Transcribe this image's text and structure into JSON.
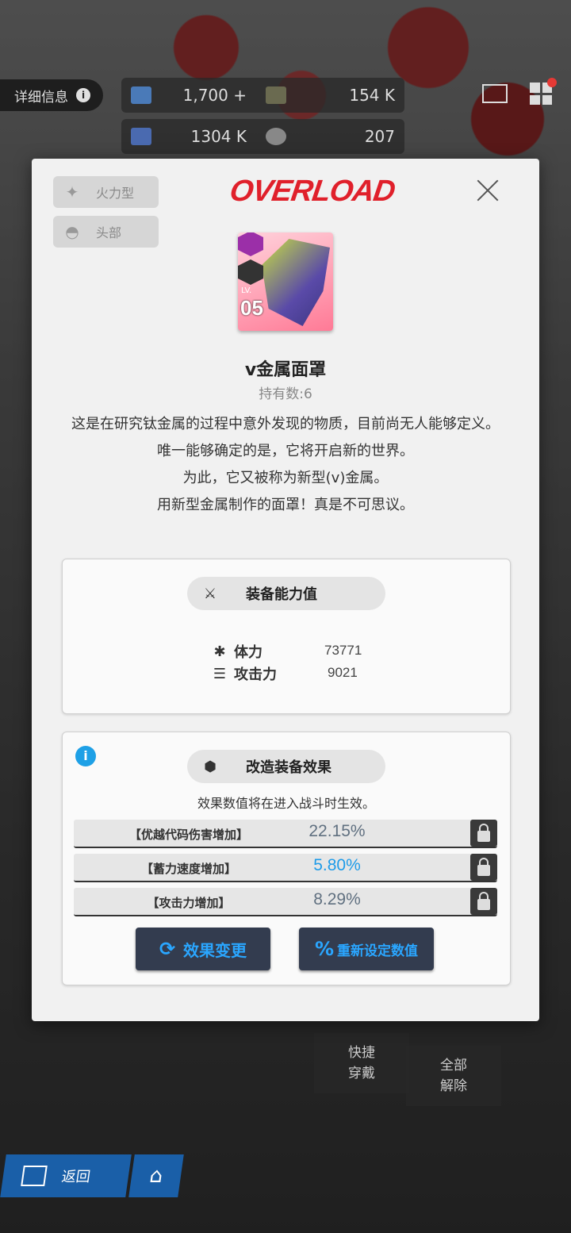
{
  "topbar": {
    "detail_label": "详细信息",
    "resources": [
      {
        "icon": "gem-icon",
        "value": "1,700",
        "extra": "+"
      },
      {
        "icon": "credit-card-icon",
        "value": "154 K"
      },
      {
        "icon": "battery-icon",
        "value": "1304 K"
      },
      {
        "icon": "core-orb-icon",
        "value": "207"
      }
    ]
  },
  "modal": {
    "tags": [
      "火力型",
      "头部"
    ],
    "brand": "OVERLOAD",
    "item": {
      "lv_label": "LV.",
      "level": "05",
      "name": "v金属面罩",
      "owned": "持有数:6"
    },
    "description": [
      "这是在研究钛金属的过程中意外发现的物质，目前尚无人能够定义。",
      "唯一能够确定的是，它将开启新的世界。",
      "为此，它又被称为新型(v)金属。",
      "用新型金属制作的面罩！真是不可思议。"
    ],
    "stats_section": {
      "title": "装备能力值",
      "stats": [
        {
          "icon": "asterisk-icon",
          "label": "体力",
          "value": "73771"
        },
        {
          "icon": "bullets-icon",
          "label": "攻击力",
          "value": "9021"
        }
      ]
    },
    "effects_section": {
      "title": "改造装备效果",
      "note": "效果数值将在进入战斗时生效。",
      "effects": [
        {
          "name": "【优越代码伤害增加】",
          "value": "22.15%",
          "color": "#607080"
        },
        {
          "name": "【蓄力速度增加】",
          "value": "5.80%",
          "color": "#1e9be8"
        },
        {
          "name": "【攻击力增加】",
          "value": "8.29%",
          "color": "#607080"
        }
      ],
      "buttons": {
        "change": "效果变更",
        "reset": "重新设定数值"
      }
    }
  },
  "underlying": {
    "quick_equip": "快捷\n穿戴",
    "unequip_all": "全部\n解除",
    "back": "返回"
  }
}
